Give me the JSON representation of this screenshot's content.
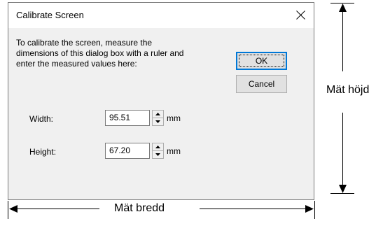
{
  "dialog": {
    "title": "Calibrate Screen",
    "instructions": "To calibrate the screen, measure the\ndimensions of this dialog box with a ruler and\nenter the measured values here:",
    "ok_label": "OK",
    "cancel_label": "Cancel",
    "close_icon": "close-icon",
    "width": {
      "label": "Width:",
      "value": "95.51",
      "unit": "mm"
    },
    "height": {
      "label": "Height:",
      "value": "67.20",
      "unit": "mm"
    }
  },
  "annotations": {
    "height_label": "Mät höjd",
    "width_label": "Mät bredd"
  }
}
